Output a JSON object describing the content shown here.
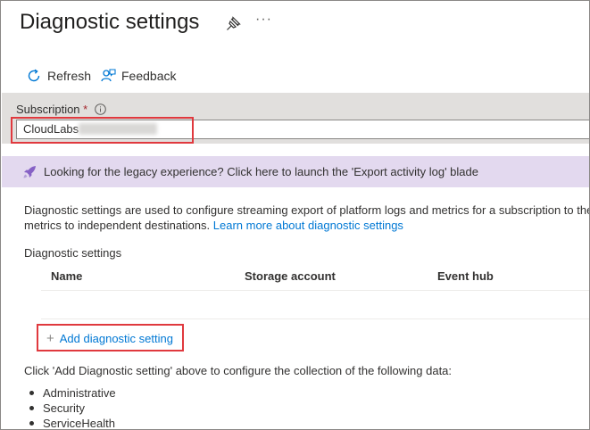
{
  "header": {
    "title": "Diagnostic settings",
    "more_label": "···"
  },
  "toolbar": {
    "refresh_label": "Refresh",
    "feedback_label": "Feedback"
  },
  "subscription": {
    "label": "Subscription",
    "required_marker": "*",
    "value": "CloudLabs"
  },
  "banner": {
    "text": "Looking for the legacy experience? Click here to launch the 'Export activity log' blade"
  },
  "description": {
    "line1": "Diagnostic settings are used to configure streaming export of platform logs and metrics for a subscription to the",
    "line2_prefix": "metrics to independent destinations. ",
    "link": "Learn more about diagnostic settings"
  },
  "settings_table": {
    "section_label": "Diagnostic settings",
    "columns": [
      "Name",
      "Storage account",
      "Event hub"
    ]
  },
  "add_setting": {
    "label": "Add diagnostic setting"
  },
  "collection": {
    "note": "Click 'Add Diagnostic setting' above to configure the collection of the following data:",
    "items": [
      "Administrative",
      "Security",
      "ServiceHealth"
    ]
  },
  "colors": {
    "accent": "#0078d4",
    "highlight": "#e0393e",
    "banner_bg": "#e3d9ef",
    "panel_bg": "#e1dfdd"
  }
}
